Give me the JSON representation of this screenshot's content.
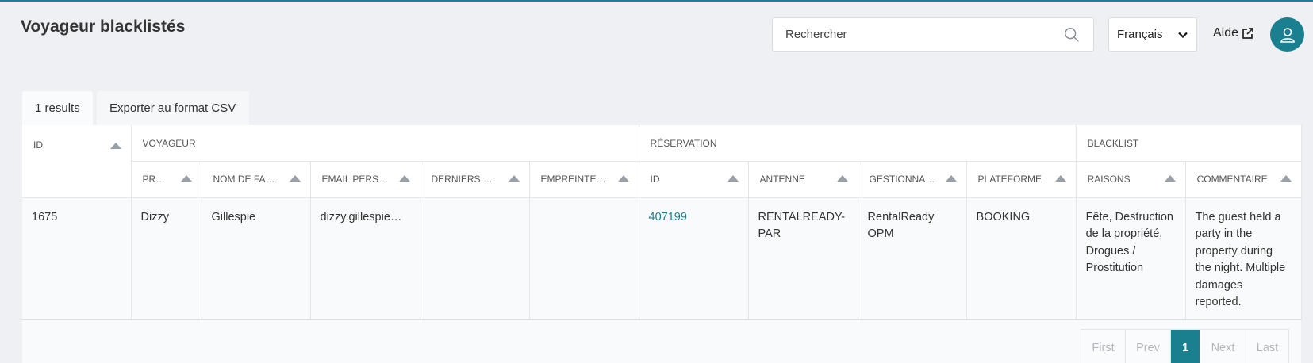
{
  "header": {
    "title": "Voyageur blacklistés",
    "search_placeholder": "Rechercher",
    "language": "Français",
    "help_label": "Aide"
  },
  "tabs": {
    "results": "1 results",
    "export": "Exporter au format CSV"
  },
  "table": {
    "groups": {
      "id": "ID",
      "voyageur": "VOYAGEUR",
      "reservation": "RÉSERVATION",
      "blacklist": "BLACKLIST"
    },
    "columns": [
      "PRÉNOM",
      "NOM DE FAMILLE",
      "EMAIL PERSONNEL",
      "DERNIERS CHIFFRES",
      "EMPREINTE CARTE",
      "ID",
      "ANTENNE",
      "GESTIONNAIRE",
      "PLATEFORME",
      "RAISONS",
      "COMMENTAIRE"
    ],
    "rows": [
      {
        "id": "1675",
        "prenom": "Dizzy",
        "nom": "Gillespie",
        "email": "dizzy.gillespie@...",
        "derniers_chiffres": "",
        "empreinte": "",
        "reservation_id": "407199",
        "antenne": "RENTALREADY-PAR",
        "gestionnaire": "RentalReady OPM",
        "plateforme": "BOOKING",
        "raisons": "Fête, Destruction de la propriété, Drogues / Prostitution",
        "commentaire": "The guest held a party in the property during the night. Multiple damages reported."
      }
    ]
  },
  "pagination": {
    "first": "First",
    "prev": "Prev",
    "current": "1",
    "next": "Next",
    "last": "Last"
  },
  "colors": {
    "accent": "#1a7f8e",
    "background": "#eef0f4"
  },
  "icons": {
    "search": "search-icon",
    "dropdown": "chevron-down-icon",
    "external": "external-link-icon",
    "user": "user-icon",
    "sort": "sort-up-icon"
  }
}
